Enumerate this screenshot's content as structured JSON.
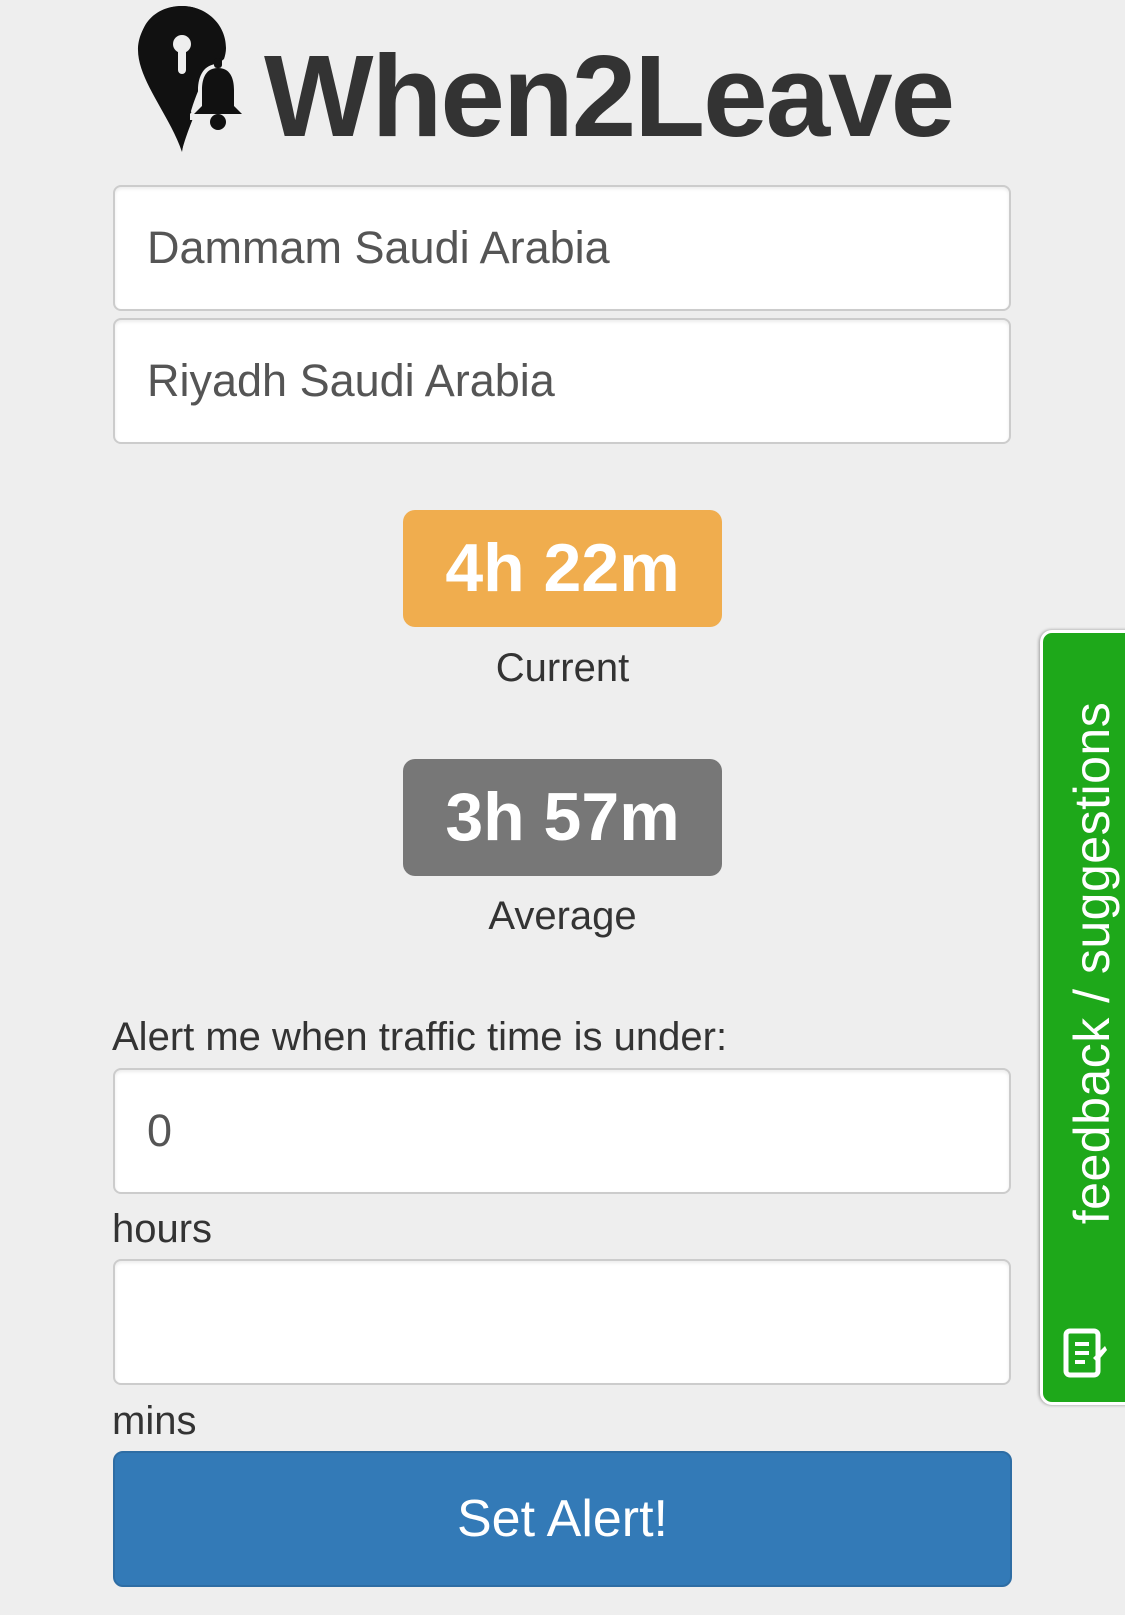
{
  "app": {
    "title": "When2Leave"
  },
  "route": {
    "origin_value": "Dammam Saudi Arabia",
    "destination_value": "Riyadh Saudi Arabia"
  },
  "times": {
    "current": {
      "value": "4h 22m",
      "label": "Current",
      "color": "#f0ad4e"
    },
    "average": {
      "value": "3h 57m",
      "label": "Average",
      "color": "#777777"
    }
  },
  "alert_form": {
    "prompt": "Alert me when traffic time is under:",
    "hours_value": "0",
    "hours_label": "hours",
    "mins_value": "",
    "mins_label": "mins",
    "submit_label": "Set Alert!",
    "submit_color": "#337ab7"
  },
  "feedback_tab": {
    "label": "feedback / suggestions",
    "icon": "note-icon",
    "color": "#1ea81a"
  },
  "logo": {
    "icon": "location-pin-bell-icon"
  }
}
